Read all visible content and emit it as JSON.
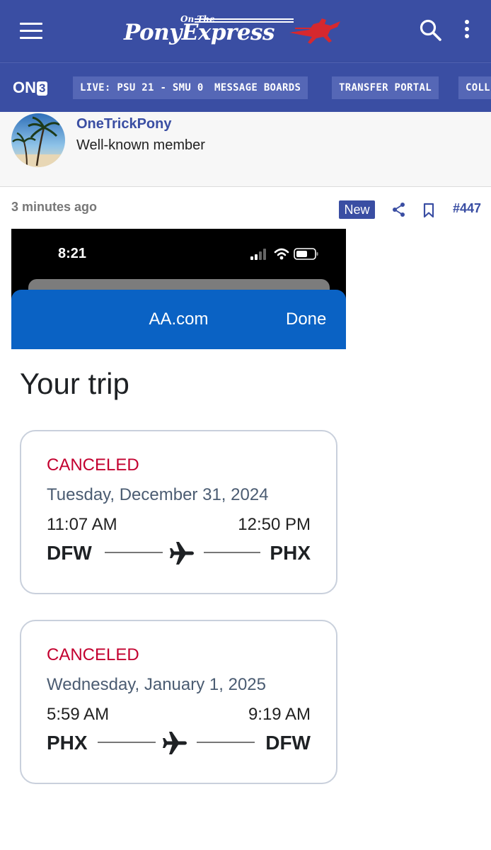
{
  "header": {
    "logo_small": "On The",
    "logo_main": "PonyExpress",
    "icons": [
      "menu-icon",
      "search-icon",
      "more-vertical-icon",
      "horse-rider-icon"
    ],
    "colors": {
      "brand": "#3a4ea3",
      "brand_red": "#d6282e"
    }
  },
  "nav": {
    "brand": "ON",
    "brand_3": "3",
    "items": [
      {
        "label": "LIVE: PSU 21 - SMU 0"
      },
      {
        "label": "MESSAGE BOARDS"
      },
      {
        "label": "TRANSFER PORTAL"
      },
      {
        "label": "COLL"
      }
    ]
  },
  "member": {
    "username": "OneTrickPony",
    "title": "Well-known member"
  },
  "post": {
    "timestamp": "3 minutes ago",
    "badge": "New",
    "number": "#447",
    "icons": [
      "share-icon",
      "bookmark-icon"
    ]
  },
  "embedded": {
    "status_time": "8:21",
    "browser_url": "AA.com",
    "browser_done": "Done",
    "trip_title": "Your trip",
    "flights": [
      {
        "status": "CANCELED",
        "date": "Tuesday, December 31, 2024",
        "depart_time": "11:07 AM",
        "arrive_time": "12:50 PM",
        "origin": "DFW",
        "destination": "PHX"
      },
      {
        "status": "CANCELED",
        "date": "Wednesday, January 1, 2025",
        "depart_time": "5:59 AM",
        "arrive_time": "9:19 AM",
        "origin": "PHX",
        "destination": "DFW"
      }
    ],
    "colors": {
      "aa_blue": "#0a62c4",
      "canceled_red": "#c3002f"
    }
  }
}
